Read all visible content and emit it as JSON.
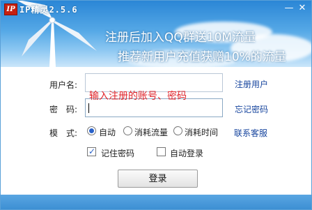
{
  "app": {
    "logo_text": "IP",
    "title": "IP精灵2.5.6"
  },
  "window_controls": {
    "minimize": "—",
    "close": "✕"
  },
  "banner": {
    "line1": "注册后加入QQ群送10M流量",
    "line2": "推荐新用户充值获赠10%的流量"
  },
  "form": {
    "username_label": "用户名:",
    "username_value": "",
    "password_label": "密　码:",
    "password_value": "",
    "hint": "输入注册的账号、密码",
    "mode_label": "模　式:",
    "modes": [
      {
        "label": "自动",
        "selected": true
      },
      {
        "label": "消耗流量",
        "selected": false
      },
      {
        "label": "消耗时间",
        "selected": false
      }
    ],
    "remember_label": "记住密码",
    "remember_checked": true,
    "autologin_label": "自动登录",
    "autologin_checked": false
  },
  "links": {
    "register": "注册用户",
    "forgot": "忘记密码",
    "support": "联系客服"
  },
  "login_button": "登录",
  "colors": {
    "banner_blue": "#2a86d6",
    "link": "#17459e",
    "hint": "#e0262c",
    "logo_red": "#c62010"
  }
}
